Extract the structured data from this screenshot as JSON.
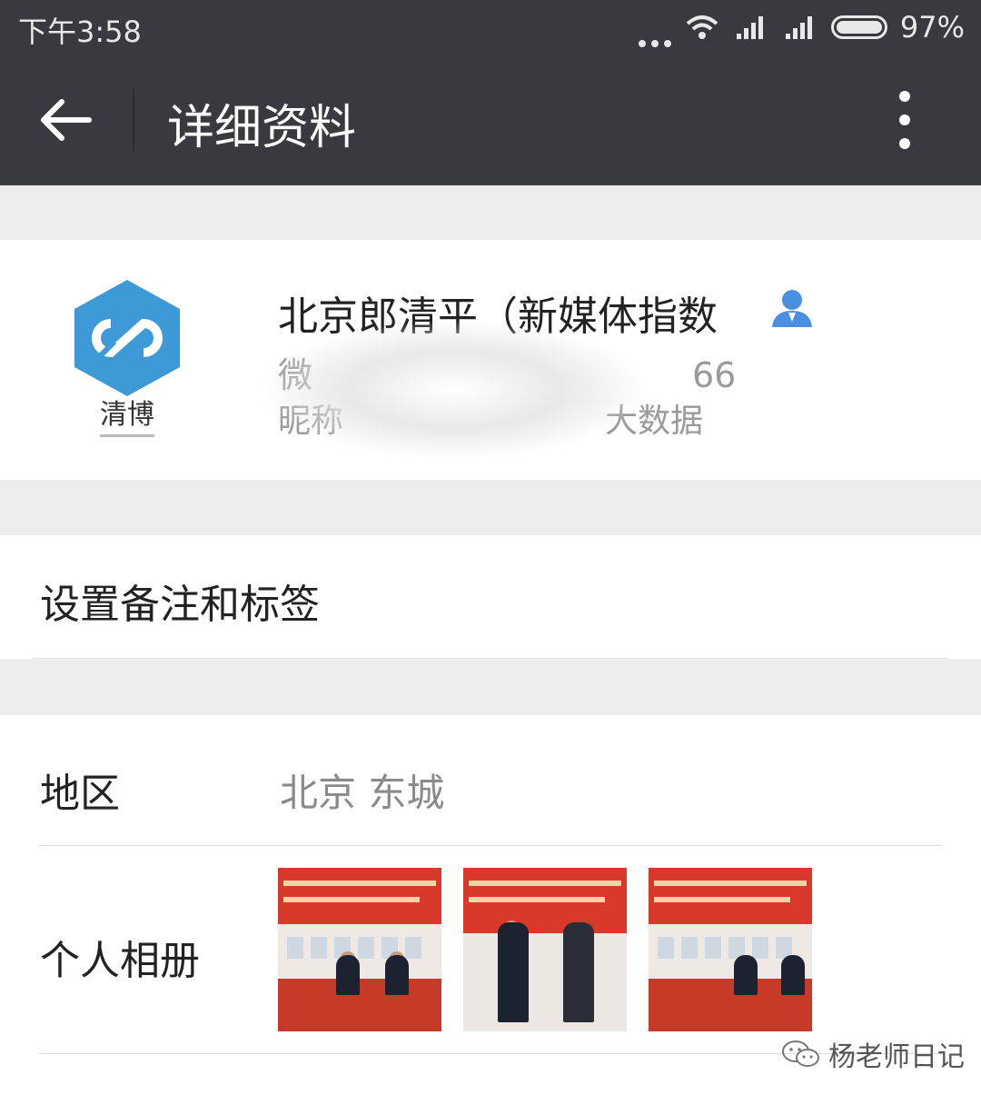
{
  "status_bar": {
    "time": "下午3:58",
    "battery": "97%"
  },
  "app_bar": {
    "title": "详细资料"
  },
  "profile": {
    "name": "北京郎清平（新媒体指数",
    "wechat_id": "微　　　　　　　　　　　66",
    "nickname": "昵称　　　　　　　　大数据",
    "avatar_caption": "清博"
  },
  "remark": {
    "label": "设置备注和标签"
  },
  "region": {
    "label": "地区",
    "value": "北京  东城"
  },
  "album": {
    "label": "个人相册"
  },
  "watermark": {
    "text": "杨老师日记"
  },
  "colors": {
    "bar": "#393a3f",
    "background": "#ededed",
    "logo_blue": "#3d9ad6",
    "verify_blue": "#4a90e2"
  }
}
